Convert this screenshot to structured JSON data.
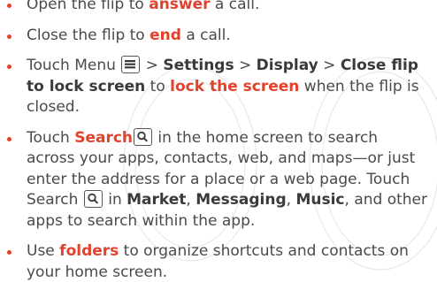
{
  "items": [
    {
      "text_a": "Open the flip to ",
      "hl_1": "answer",
      "text_b": " a call."
    },
    {
      "text_a": "Close the flip to ",
      "hl_1": "end",
      "text_b": " a call."
    },
    {
      "text_a": "Touch Menu ",
      "sep_1": " > ",
      "b_1": "Settings",
      "sep_2": " > ",
      "b_2": "Display",
      "sep_3": " > ",
      "b_3": "Close flip to lock screen",
      "text_b": " to ",
      "hl_1": "lock the screen",
      "text_c": " when the flip is closed."
    },
    {
      "text_a": "Touch ",
      "hl_1": "Search",
      "text_b": " in the home screen to search across your apps, contacts, web, and maps—or just enter the address for a place or a web page. Touch Search ",
      "text_c": " in ",
      "b_1": "Market",
      "sep_1": ", ",
      "b_2": "Messaging",
      "sep_2": ", ",
      "b_3": "Music",
      "text_d": ", and other apps to search within the app."
    },
    {
      "text_a": "Use ",
      "hl_1": "folders",
      "text_b": " to organize shortcuts and contacts on your home screen."
    }
  ],
  "icons": {
    "menu_key": "menu-key-icon",
    "search_key": "search-key-icon"
  },
  "colors": {
    "highlight": "#e2422c",
    "body_text": "#4a4a4a",
    "bullet": "#e2422c"
  }
}
